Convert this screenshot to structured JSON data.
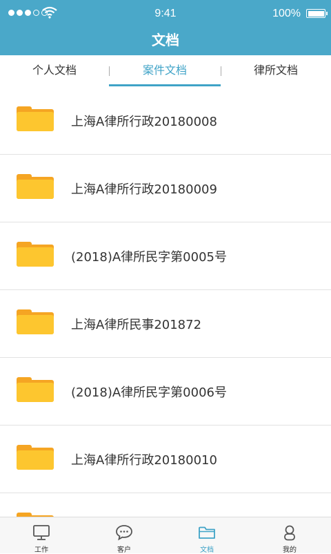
{
  "status_bar": {
    "time": "9:41",
    "battery": "100%",
    "signal_icon": "signal-dots-icon",
    "wifi_icon": "wifi-icon",
    "battery_icon": "battery-icon"
  },
  "header": {
    "title": "文档",
    "color": "#4aa8c9"
  },
  "tabs": [
    {
      "label": "个人文档",
      "active": false
    },
    {
      "label": "案件文档",
      "active": true
    },
    {
      "label": "律所文档",
      "active": false
    }
  ],
  "folders": [
    {
      "name": "上海A律所行政20180008",
      "icon": "folder-icon"
    },
    {
      "name": "上海A律所行政20180009",
      "icon": "folder-icon"
    },
    {
      "name": "(2018)A律所民字第0005号",
      "icon": "folder-icon"
    },
    {
      "name": "上海A律所民事201872",
      "icon": "folder-icon"
    },
    {
      "name": "(2018)A律所民字第0006号",
      "icon": "folder-icon"
    },
    {
      "name": "上海A律所行政20180010",
      "icon": "folder-icon"
    }
  ],
  "bottom_nav": [
    {
      "label": "工作",
      "icon": "monitor-icon",
      "active": false
    },
    {
      "label": "客户",
      "icon": "chat-bubble-icon",
      "active": false
    },
    {
      "label": "文档",
      "icon": "folder-icon",
      "active": true
    },
    {
      "label": "我的",
      "icon": "person-icon",
      "active": false
    }
  ],
  "colors": {
    "accent": "#3fa3c7",
    "folder_front": "#fdc62f",
    "folder_back": "#f5a523"
  }
}
